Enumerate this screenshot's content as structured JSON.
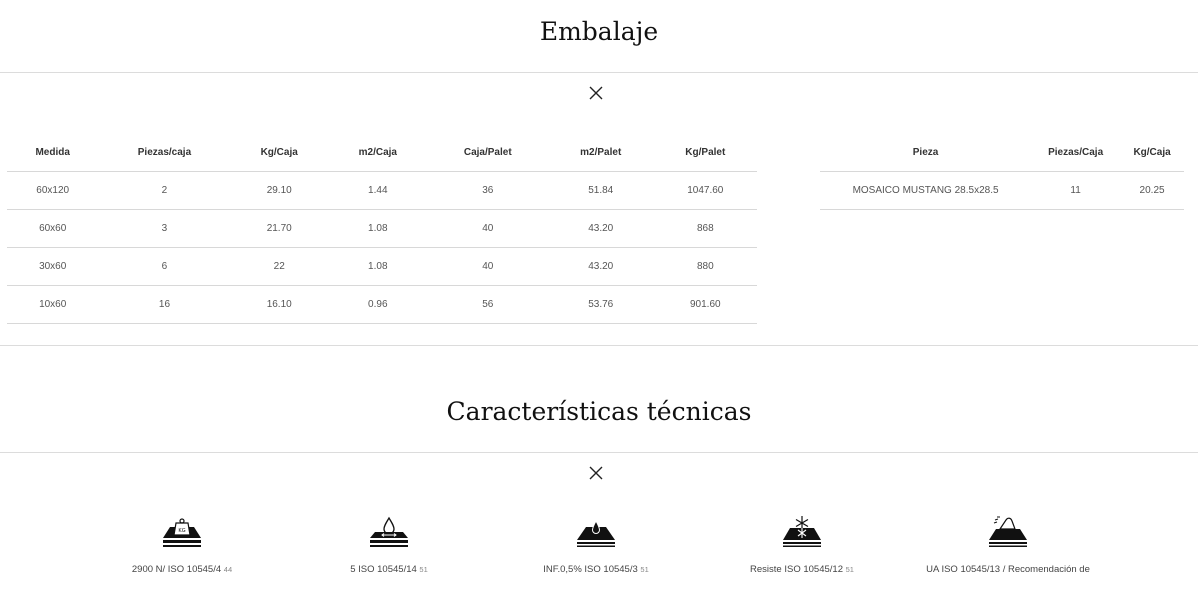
{
  "packaging": {
    "title": "Embalaje",
    "table1": {
      "headers": [
        "Medida",
        "Piezas/caja",
        "Kg/Caja",
        "m2/Caja",
        "Caja/Palet",
        "m2/Palet",
        "Kg/Palet"
      ],
      "rows": [
        [
          "60x120",
          "2",
          "29.10",
          "1.44",
          "36",
          "51.84",
          "1047.60"
        ],
        [
          "60x60",
          "3",
          "21.70",
          "1.08",
          "40",
          "43.20",
          "868"
        ],
        [
          "30x60",
          "6",
          "22",
          "1.08",
          "40",
          "43.20",
          "880"
        ],
        [
          "10x60",
          "16",
          "16.10",
          "0.96",
          "56",
          "53.76",
          "901.60"
        ]
      ]
    },
    "table2": {
      "headers": [
        "Pieza",
        "Piezas/Caja",
        "Kg/Caja"
      ],
      "rows": [
        [
          "MOSAICO MUSTANG 28.5x28.5",
          "11",
          "20.25"
        ]
      ]
    }
  },
  "technical": {
    "title": "Características técnicas",
    "features": [
      {
        "icon": "weight-load-icon",
        "text": "2900 N/ ISO 10545/4",
        "sub": "44"
      },
      {
        "icon": "water-drop-surface-icon",
        "text": "5 ISO 10545/14",
        "sub": "51"
      },
      {
        "icon": "water-absorption-icon",
        "text": "INF.0,5% ISO 10545/3",
        "sub": "51"
      },
      {
        "icon": "frost-resistance-icon",
        "text": "Resiste ISO 10545/12",
        "sub": "51"
      },
      {
        "icon": "chemical-resistance-icon",
        "text": "UA ISO 10545/13 / Recomendación de",
        "sub": ""
      }
    ]
  },
  "colors": {
    "text": "#222222",
    "divider": "#dcdcdc",
    "icon": "#111111"
  }
}
